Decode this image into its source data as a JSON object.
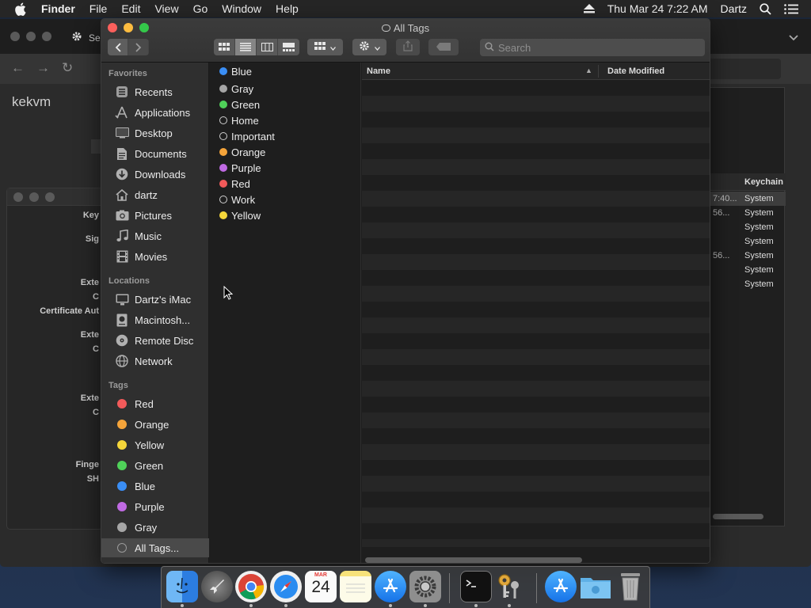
{
  "menubar": {
    "app_name": "Finder",
    "menus": [
      "File",
      "Edit",
      "View",
      "Go",
      "Window",
      "Help"
    ],
    "clock": "Thu Mar 24  7:22 AM",
    "user": "Dartz"
  },
  "background": {
    "browser_partial_title": "Se",
    "browser_brand": "kekvm",
    "keychain": {
      "column_header": "Keychain",
      "rows": [
        {
          "date": "7:40...",
          "keychain": "System"
        },
        {
          "date": "56...",
          "keychain": "System"
        },
        {
          "date": "",
          "keychain": "System"
        },
        {
          "date": "",
          "keychain": "System"
        },
        {
          "date": "56...",
          "keychain": "System"
        },
        {
          "date": "",
          "keychain": "System"
        },
        {
          "date": "",
          "keychain": "System"
        }
      ]
    },
    "certificate_labels": [
      "Key",
      "Sig",
      "Exte",
      "C",
      "Certificate Aut",
      "Exte",
      "C",
      "Exte",
      "C",
      "Finge",
      "SH"
    ]
  },
  "finder": {
    "title": "All Tags",
    "search_placeholder": "Search",
    "sidebar": {
      "favorites_header": "Favorites",
      "favorites": [
        {
          "label": "Recents",
          "icon": "recents-icon"
        },
        {
          "label": "Applications",
          "icon": "applications-icon"
        },
        {
          "label": "Desktop",
          "icon": "desktop-icon"
        },
        {
          "label": "Documents",
          "icon": "documents-icon"
        },
        {
          "label": "Downloads",
          "icon": "downloads-icon"
        },
        {
          "label": "dartz",
          "icon": "home-icon"
        },
        {
          "label": "Pictures",
          "icon": "pictures-icon"
        },
        {
          "label": "Music",
          "icon": "music-icon"
        },
        {
          "label": "Movies",
          "icon": "movies-icon"
        }
      ],
      "locations_header": "Locations",
      "locations": [
        {
          "label": "Dartz's iMac",
          "icon": "imac-icon"
        },
        {
          "label": "Macintosh...",
          "icon": "disk-icon"
        },
        {
          "label": "Remote Disc",
          "icon": "remote-disc-icon"
        },
        {
          "label": "Network",
          "icon": "network-icon"
        }
      ],
      "tags_header": "Tags",
      "tags": [
        {
          "label": "Red",
          "color": "#f25a5a"
        },
        {
          "label": "Orange",
          "color": "#f5a43a"
        },
        {
          "label": "Yellow",
          "color": "#f5d63a"
        },
        {
          "label": "Green",
          "color": "#4fd159"
        },
        {
          "label": "Blue",
          "color": "#3a8ef5"
        },
        {
          "label": "Purple",
          "color": "#c06ae3"
        },
        {
          "label": "Gray",
          "color": "#a6a6a6"
        }
      ],
      "all_tags_label": "All Tags..."
    },
    "tag_column": [
      {
        "label": "Blue",
        "color": "#3a8ef5"
      },
      {
        "label": "Gray",
        "color": "#a6a6a6"
      },
      {
        "label": "Green",
        "color": "#4fd159"
      },
      {
        "label": "Home",
        "color": ""
      },
      {
        "label": "Important",
        "color": ""
      },
      {
        "label": "Orange",
        "color": "#f5a43a"
      },
      {
        "label": "Purple",
        "color": "#c06ae3"
      },
      {
        "label": "Red",
        "color": "#f25a5a"
      },
      {
        "label": "Work",
        "color": ""
      },
      {
        "label": "Yellow",
        "color": "#f5d63a"
      }
    ],
    "list_headers": {
      "name": "Name",
      "date_modified": "Date Modified"
    }
  },
  "dock": {
    "calendar_month": "MAR",
    "calendar_day": "24",
    "apps": [
      "finder-icon",
      "launchpad-icon",
      "chrome-icon",
      "safari-icon",
      "calendar-icon",
      "notes-icon",
      "app-store-icon",
      "system-preferences-icon",
      "terminal-icon",
      "keychain-access-icon",
      "app-store-folder-icon",
      "folder-icon",
      "trash-icon"
    ]
  }
}
